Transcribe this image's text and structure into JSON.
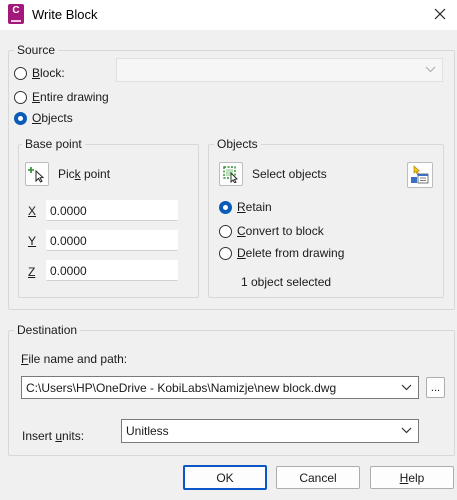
{
  "window": {
    "title": "Write Block",
    "app_icon_letter": "C"
  },
  "source": {
    "legend": "Source",
    "options": [
      {
        "label": "Block:",
        "key": "B",
        "rest": "lock:",
        "checked": false
      },
      {
        "label": "Entire drawing",
        "key": "E",
        "rest": "ntire drawing",
        "checked": false
      },
      {
        "label": "Objects",
        "key": "O",
        "rest": "bjects",
        "checked": true
      }
    ],
    "block_select_value": ""
  },
  "base_point": {
    "legend": "Base point",
    "pick_label_pre": "Pic",
    "pick_label_key": "k",
    "pick_label_post": " point",
    "x_label": "X",
    "y_label": "Y",
    "z_label": "Z",
    "x_value": "0.0000",
    "y_value": "0.0000",
    "z_value": "0.0000"
  },
  "objects": {
    "legend": "Objects",
    "select_pre": "Select ob",
    "select_key": "j",
    "select_post": "ects",
    "options": [
      {
        "key": "R",
        "rest": "etain",
        "checked": true
      },
      {
        "key": "C",
        "rest": "onvert to block",
        "checked": false
      },
      {
        "key": "D",
        "rest": "elete from drawing",
        "checked": false
      }
    ],
    "status": "1 object selected"
  },
  "destination": {
    "legend": "Destination",
    "file_label_key": "F",
    "file_label_rest": "ile name and path:",
    "file_path": "C:\\Users\\HP\\OneDrive - KobiLabs\\Namizje\\new block.dwg",
    "browse_label": "...",
    "units_label_pre": "Insert ",
    "units_label_key": "u",
    "units_label_post": "nits:",
    "units_value": "Unitless"
  },
  "buttons": {
    "ok": "OK",
    "cancel": "Cancel",
    "help_key": "H",
    "help_rest": "elp"
  },
  "colors": {
    "accent": "#0a5cb8",
    "app_icon": "#a2197b",
    "dialog_bg": "#f0f0f0"
  }
}
